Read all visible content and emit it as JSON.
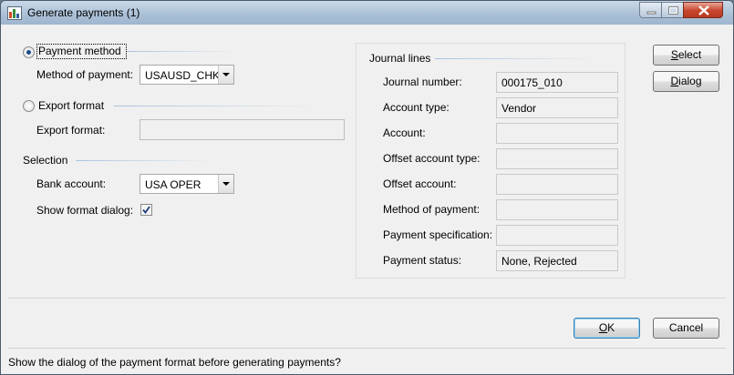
{
  "window": {
    "title": "Generate payments (1)"
  },
  "left": {
    "payment_method_radio": "Payment method",
    "method_of_payment_label": "Method of payment:",
    "method_of_payment_value": "USAUSD_CHK",
    "export_format_radio": "Export format",
    "export_format_label": "Export format:",
    "export_format_value": "",
    "selection_heading": "Selection",
    "bank_account_label": "Bank account:",
    "bank_account_value": "USA OPER",
    "show_format_dialog_label": "Show format dialog:",
    "show_format_dialog_checked": true
  },
  "journal": {
    "heading": "Journal lines",
    "rows": [
      {
        "label": "Journal number:",
        "value": "000175_010"
      },
      {
        "label": "Account type:",
        "value": "Vendor"
      },
      {
        "label": "Account:",
        "value": ""
      },
      {
        "label": "Offset account type:",
        "value": ""
      },
      {
        "label": "Offset account:",
        "value": ""
      },
      {
        "label": "Method of payment:",
        "value": ""
      },
      {
        "label": "Payment specification:",
        "value": ""
      },
      {
        "label": "Payment status:",
        "value": "None, Rejected"
      }
    ]
  },
  "buttons": {
    "select": "Select",
    "dialog": "Dialog",
    "ok": "OK",
    "cancel": "Cancel"
  },
  "status_bar": {
    "text": "Show the dialog of the payment format before generating payments?"
  },
  "icons": [
    "app-icon",
    "minimize-icon",
    "maximize-icon",
    "close-icon",
    "checkmark-icon",
    "dropdown-arrow-icon"
  ]
}
